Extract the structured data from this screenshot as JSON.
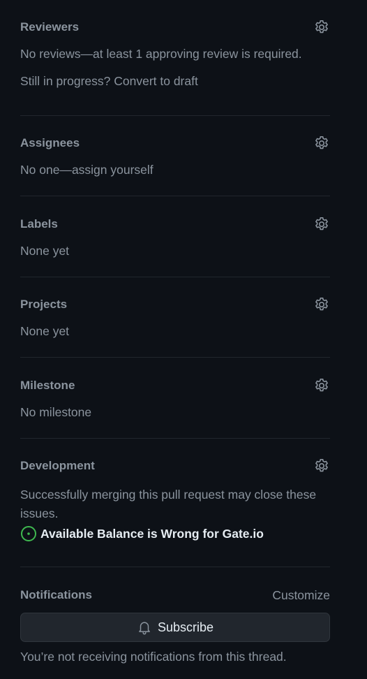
{
  "reviewers": {
    "heading": "Reviewers",
    "status": "No reviews—at least 1 approving review is required.",
    "draft_prompt": "Still in progress? ",
    "draft_link": "Convert to draft"
  },
  "assignees": {
    "heading": "Assignees",
    "status_prefix": "No one—",
    "assign_link": "assign yourself"
  },
  "labels": {
    "heading": "Labels",
    "status": "None yet"
  },
  "projects": {
    "heading": "Projects",
    "status": "None yet"
  },
  "milestone": {
    "heading": "Milestone",
    "status": "No milestone"
  },
  "development": {
    "heading": "Development",
    "description": "Successfully merging this pull request may close these issues.",
    "linked_issue": {
      "title": "Available Balance is Wrong for Gate.io",
      "state_icon": "issue-opened-icon",
      "state_color": "#3fb950"
    }
  },
  "notifications": {
    "heading": "Notifications",
    "customize_label": "Customize",
    "subscribe_label": "Subscribe",
    "status": "You’re not receiving notifications from this thread."
  },
  "colors": {
    "background": "#0d1117",
    "muted_text": "#8b949e",
    "primary_text": "#e6edf3",
    "divider": "#21262d",
    "button_bg": "#21262d",
    "button_border": "#30363d",
    "open_issue": "#3fb950"
  }
}
